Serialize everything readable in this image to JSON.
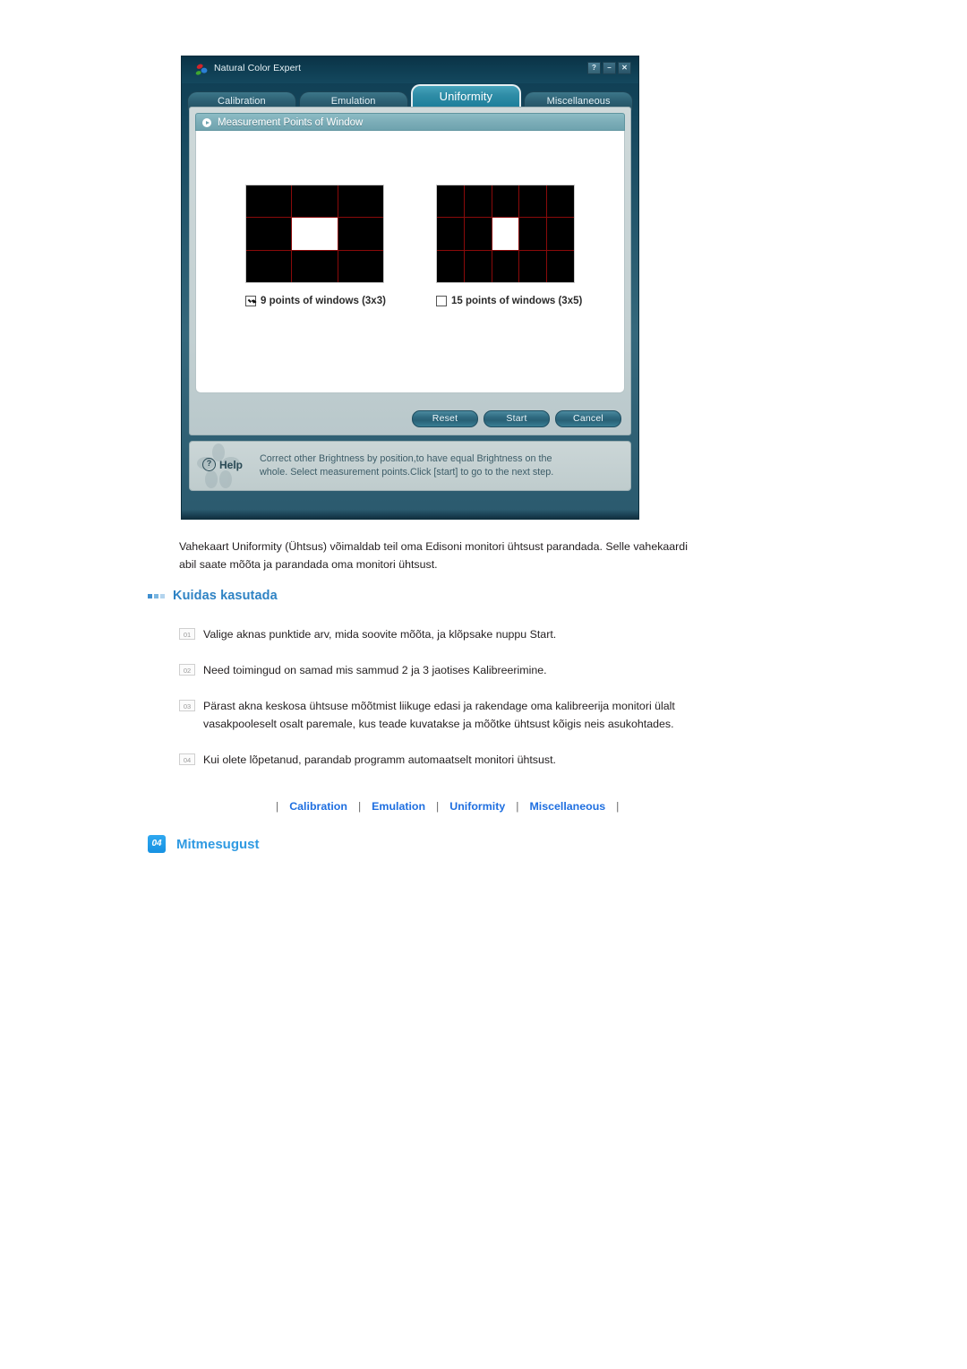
{
  "app": {
    "title": "Natural Color Expert",
    "logo_icon": "color-dots-logo-icon",
    "window_buttons": [
      {
        "name": "help-button",
        "glyph": "?"
      },
      {
        "name": "minimize-button",
        "glyph": "–"
      },
      {
        "name": "close-button",
        "glyph": "✕"
      }
    ],
    "tabs": [
      {
        "label": "Calibration",
        "active": false
      },
      {
        "label": "Emulation",
        "active": false
      },
      {
        "label": "Uniformity",
        "active": true
      },
      {
        "label": "Miscellaneous",
        "active": false
      }
    ],
    "group": {
      "title": "Measurement Points of Window",
      "bullet_icon": "play-circle-icon"
    },
    "options": [
      {
        "label": "9 points of windows (3x3)",
        "checked": true,
        "cols": 3,
        "rows": 3,
        "lit_index": 4
      },
      {
        "label": "15 points of windows (3x5)",
        "checked": false,
        "cols": 5,
        "rows": 3,
        "lit_index": 7
      }
    ],
    "buttons": [
      {
        "label": "Reset",
        "name": "reset-button"
      },
      {
        "label": "Start",
        "name": "start-button"
      },
      {
        "label": "Cancel",
        "name": "cancel-button"
      }
    ],
    "help": {
      "label": "Help",
      "icon": "question-circle-icon",
      "line1": "Correct other Brightness by position,to have equal Brightness on the",
      "line2": "whole. Select measurement points.Click [start] to go to the next step."
    },
    "colors": {
      "titlebar": "#0f3f54",
      "tab_active": "#2f8ca6",
      "panel": "#c3d0d2",
      "grid_line": "#8a0a0a",
      "grid_cell": "#000000",
      "grid_lit": "#ffffff"
    }
  },
  "doc": {
    "intro": "Vahekaart Uniformity (Ühtsus) võimaldab teil oma Edisoni monitori ühtsust parandada. Selle vahekaardi abil saate mõõta ja parandada oma monitori ühtsust.",
    "section_title": "Kuidas kasutada",
    "steps": [
      {
        "num": "01",
        "text": "Valige aknas punktide arv, mida soovite mõõta, ja klõpsake nuppu Start."
      },
      {
        "num": "02",
        "text": "Need toimingud on samad mis sammud 2 ja 3 jaotises Kalibreerimine."
      },
      {
        "num": "03",
        "text": "Pärast akna keskosa ühtsuse mõõtmist liikuge edasi ja rakendage oma kalibreerija monitori ülalt vasakpooleselt osalt paremale, kus teade kuvatakse ja mõõtke ühtsust kõigis neis asukohtades."
      },
      {
        "num": "04",
        "text": "Kui olete lõpetanud, parandab programm automaatselt monitori ühtsust."
      }
    ],
    "navlinks": [
      "Calibration",
      "Emulation",
      "Uniformity",
      "Miscellaneous"
    ],
    "nav_separator": "|",
    "bottom_section": {
      "badge": "04",
      "title": "Mitmesugust"
    },
    "colors": {
      "heading": "#2f83c4",
      "link": "#1f6fe0",
      "badge": "#1691e2",
      "text": "#231f20"
    }
  }
}
